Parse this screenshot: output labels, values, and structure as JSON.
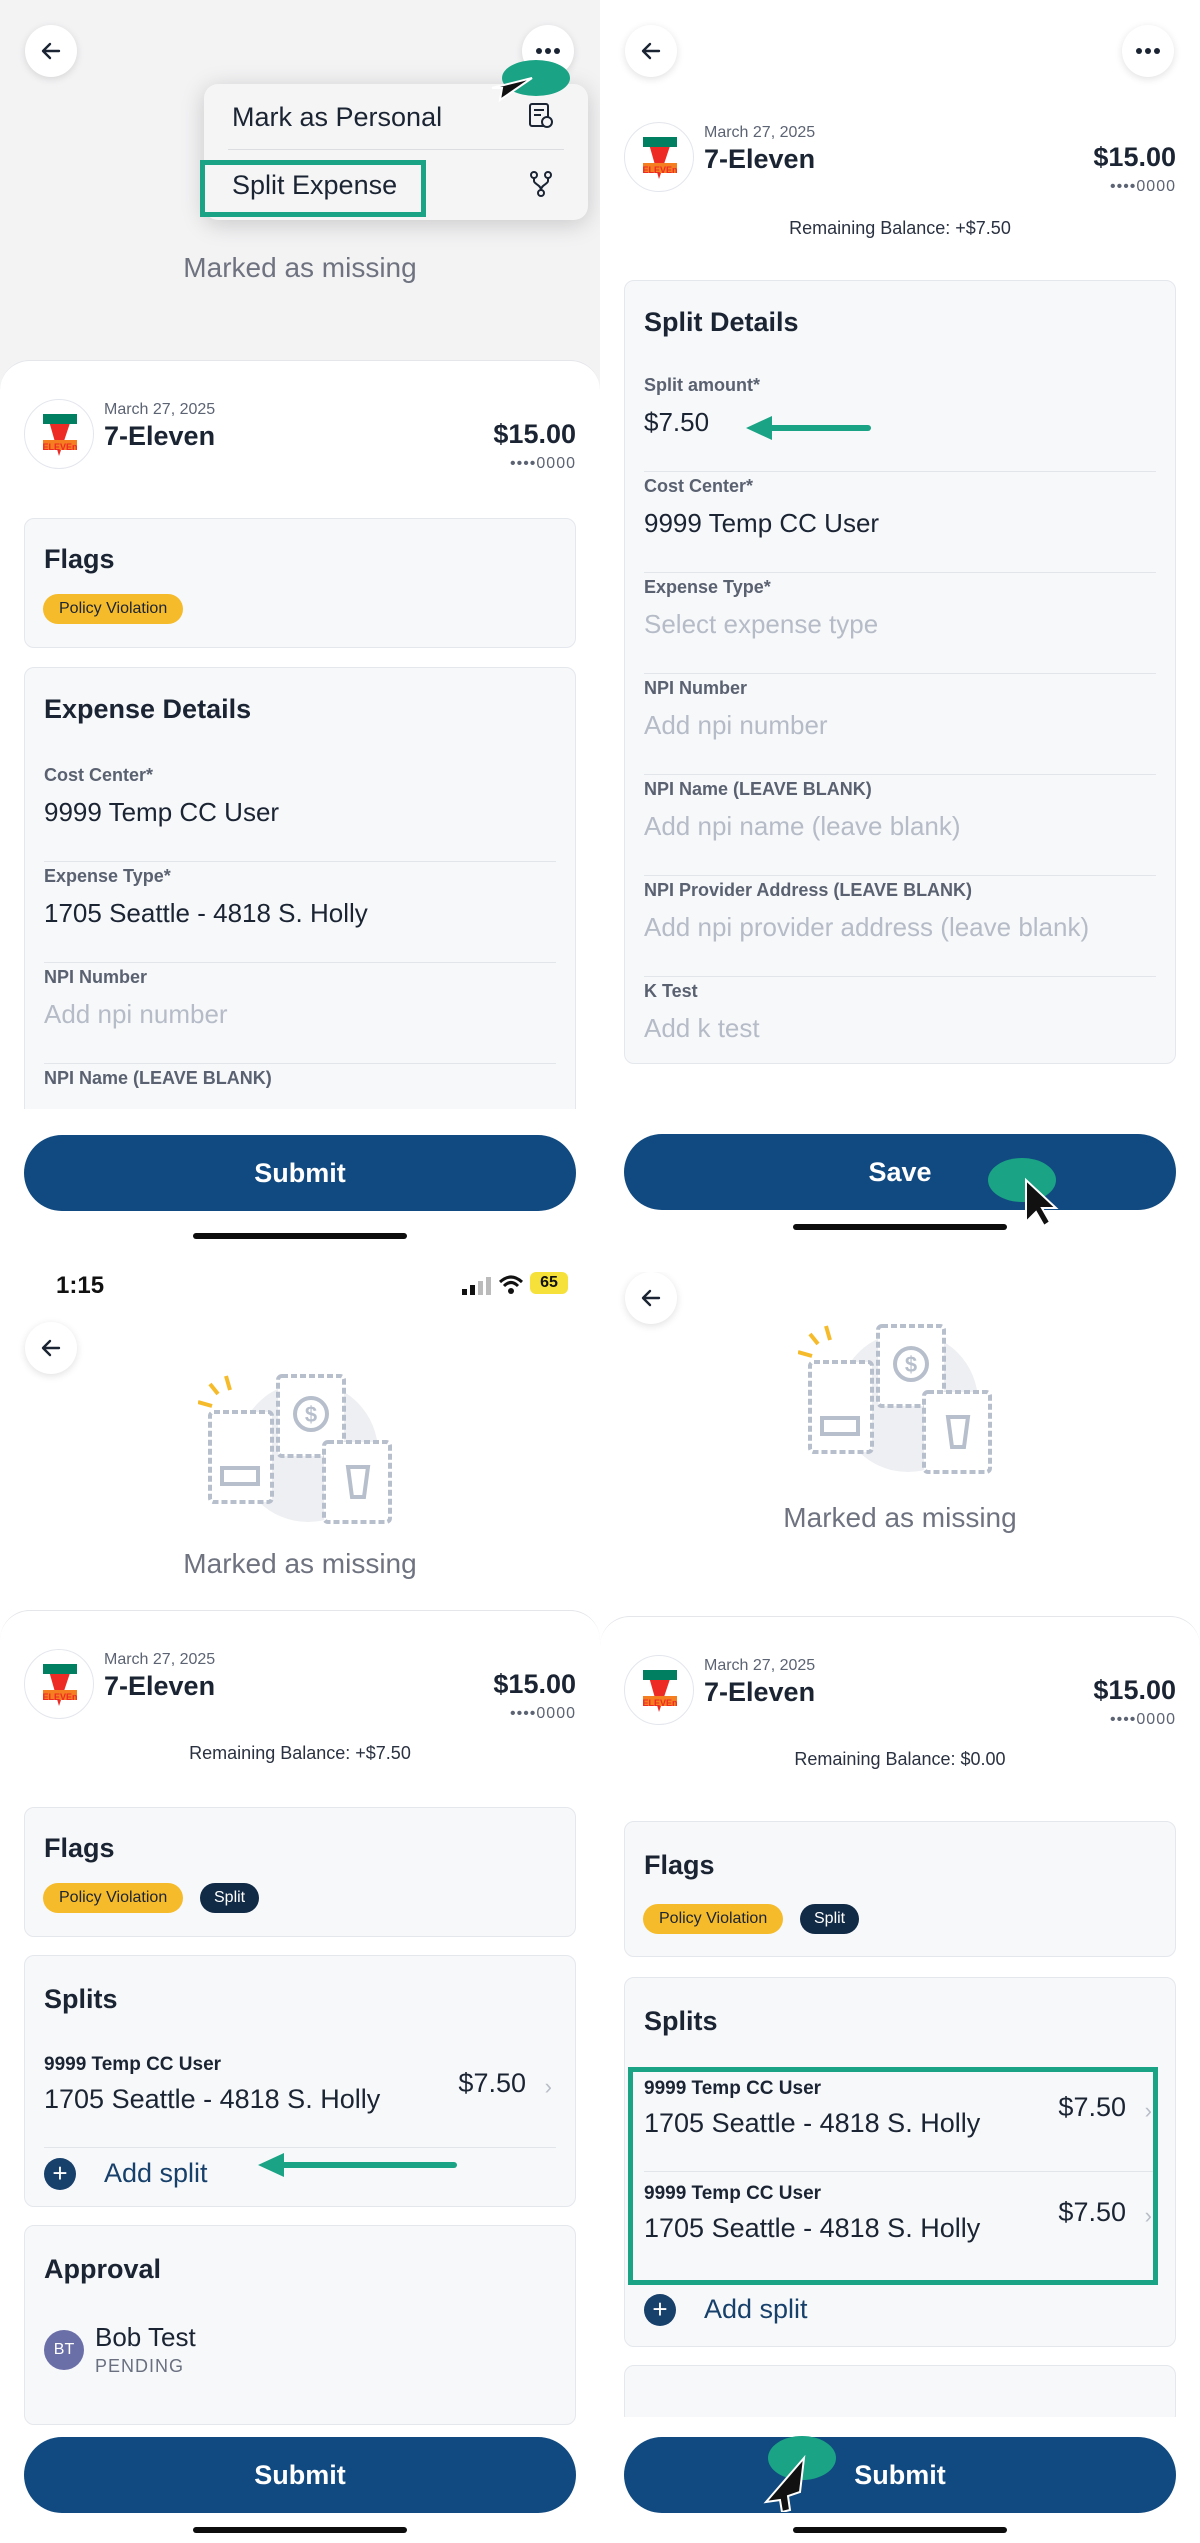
{
  "merchant": {
    "date": "March 27, 2025",
    "name": "7-Eleven",
    "amount": "$15.00",
    "card": "••••0000",
    "logo_text": "ELEVEn",
    "logo_number": "7"
  },
  "missing_label": "Marked as missing",
  "menu": {
    "mark_personal": "Mark as Personal",
    "split_expense": "Split Expense"
  },
  "flags": {
    "title": "Flags",
    "policy_violation": "Policy Violation",
    "split": "Split"
  },
  "expense_details": {
    "title": "Expense Details",
    "cost_center_label": "Cost Center*",
    "cost_center_value": "9999 Temp CC User",
    "expense_type_label": "Expense Type*",
    "expense_type_value": "1705 Seattle - 4818 S. Holly",
    "npi_number_label": "NPI Number",
    "npi_number_placeholder": "Add npi number",
    "npi_name_label": "NPI Name (LEAVE BLANK)"
  },
  "split_details": {
    "remaining_balance": "Remaining Balance: +$7.50",
    "title": "Split Details",
    "split_amount_label": "Split amount*",
    "split_amount_value": "$7.50",
    "cost_center_label": "Cost Center*",
    "cost_center_value": "9999 Temp CC User",
    "expense_type_label": "Expense Type*",
    "expense_type_placeholder": "Select expense type",
    "npi_number_label": "NPI Number",
    "npi_number_placeholder": "Add npi number",
    "npi_name_label": "NPI Name (LEAVE BLANK)",
    "npi_name_placeholder": "Add npi name (leave blank)",
    "npi_address_label": "NPI Provider Address (LEAVE BLANK)",
    "npi_address_placeholder": "Add npi provider address (leave blank)",
    "k_test_label": "K Test",
    "k_test_placeholder": "Add k test"
  },
  "buttons": {
    "submit": "Submit",
    "save": "Save"
  },
  "status_bar": {
    "time": "1:15",
    "battery": "65"
  },
  "splits_screen_1": {
    "remaining_balance": "Remaining Balance: +$7.50",
    "splits_title": "Splits",
    "rows": [
      {
        "cost_center": "9999 Temp CC User",
        "expense_type": "1705 Seattle - 4818 S. Holly",
        "amount": "$7.50"
      }
    ],
    "add_split": "Add split",
    "approval_title": "Approval",
    "approver_initials": "BT",
    "approver_name": "Bob Test",
    "approver_status": "PENDING"
  },
  "splits_screen_2": {
    "remaining_balance": "Remaining Balance: $0.00",
    "splits_title": "Splits",
    "rows": [
      {
        "cost_center": "9999 Temp CC User",
        "expense_type": "1705 Seattle - 4818 S. Holly",
        "amount": "$7.50"
      },
      {
        "cost_center": "9999 Temp CC User",
        "expense_type": "1705 Seattle - 4818 S. Holly",
        "amount": "$7.50"
      }
    ],
    "add_split": "Add split"
  },
  "colors": {
    "primary_button": "#114a80",
    "highlight": "#1aa384",
    "policy_badge": "#f6bb2b",
    "split_badge": "#112a46"
  }
}
